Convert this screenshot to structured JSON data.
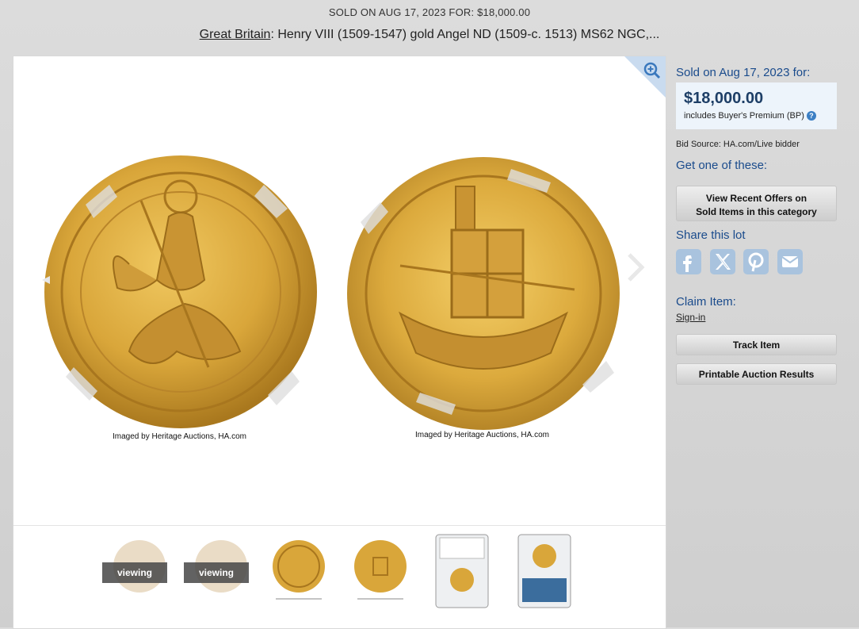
{
  "header": {
    "sold_status": "SOLD ON AUG 17, 2023 FOR: $18,000.00",
    "title_link": "Great Britain",
    "title_rest": ": Henry VIII (1509-1547) gold Angel ND (1509-c. 1513) MS62 NGC,..."
  },
  "viewer": {
    "caption_left": "Imaged by Heritage Auctions, HA.com",
    "caption_right": "Imaged by Heritage Auctions, HA.com",
    "zoom_icon": "zoom-in-icon",
    "prev_icon": "chevron-left-icon",
    "next_icon": "chevron-right-icon"
  },
  "thumbnails": [
    {
      "name": "obverse-thumb",
      "badge": "viewing"
    },
    {
      "name": "reverse-thumb",
      "badge": "viewing"
    },
    {
      "name": "obverse-thumb-2",
      "badge": ""
    },
    {
      "name": "reverse-thumb-2",
      "badge": ""
    },
    {
      "name": "slab-front-thumb",
      "badge": ""
    },
    {
      "name": "slab-back-thumb",
      "badge": ""
    }
  ],
  "sidebar": {
    "sold_on": "Sold on Aug 17, 2023 for:",
    "price": "$18,000.00",
    "bp_note": "includes Buyer's Premium (BP)",
    "bp_help": "?",
    "bid_source": "Bid Source: HA.com/Live bidder",
    "get_one": "Get one of these:",
    "recent_offers_line1": "View Recent Offers on",
    "recent_offers_line2": "Sold Items in this category",
    "share": "Share this lot",
    "claim": "Claim Item:",
    "signin": "Sign-in",
    "track": "Track Item",
    "printable": "Printable Auction Results"
  },
  "colors": {
    "accent_blue": "#1a4b8c",
    "price_box": "#edf4fb",
    "social_icon": "#a9c3de",
    "gold": "#d9a63a"
  }
}
